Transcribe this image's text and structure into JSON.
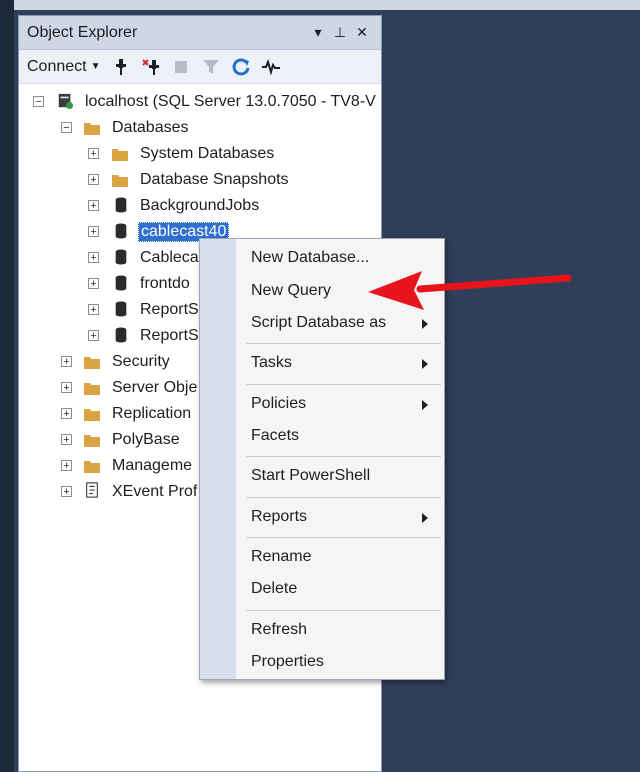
{
  "panel": {
    "title": "Object Explorer",
    "title_buttons": [
      "▾",
      "⊥",
      "✕"
    ],
    "toolbar": {
      "connect_label": "Connect",
      "icons": [
        "connect-icon",
        "disconnect-icon",
        "stop-icon",
        "filter-icon",
        "refresh-icon",
        "activity-monitor-icon"
      ]
    }
  },
  "tree": {
    "server": "localhost (SQL Server 13.0.7050 - TV8-V",
    "databases": "Databases",
    "system_databases": "System Databases",
    "database_snapshots": "Database Snapshots",
    "db_items": [
      "BackgroundJobs",
      "cablecast40",
      "Cableca",
      "frontdo",
      "ReportS",
      "ReportS"
    ],
    "server_nodes": [
      "Security",
      "Server Obje",
      "Replication",
      "PolyBase",
      "Manageme",
      "XEvent Prof"
    ]
  },
  "context_menu": {
    "items": [
      {
        "label": "New Database..."
      },
      {
        "label": "New Query"
      },
      {
        "label": "Script Database as"
      },
      {
        "label": "Tasks"
      },
      {
        "label": "Policies"
      },
      {
        "label": "Facets"
      },
      {
        "label": "Start PowerShell"
      },
      {
        "label": "Reports"
      },
      {
        "label": "Rename"
      },
      {
        "label": "Delete"
      },
      {
        "label": "Refresh"
      },
      {
        "label": "Properties"
      }
    ]
  },
  "colors": {
    "accent_selection": "#2f6fd0",
    "annotation_arrow": "#e8141b",
    "right_background": "#2f3f59"
  }
}
